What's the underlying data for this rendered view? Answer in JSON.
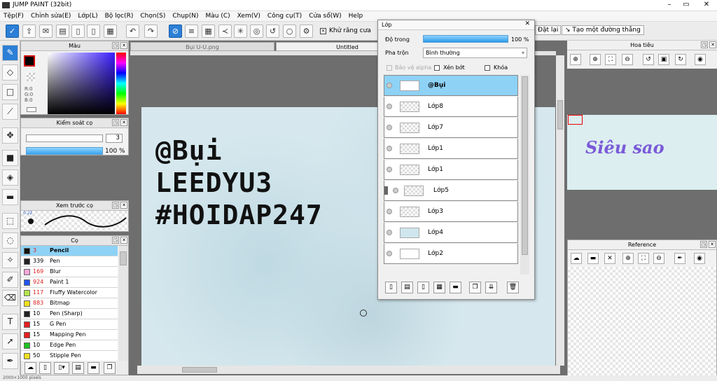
{
  "window": {
    "title": "JUMP PAINT (32bit)"
  },
  "menu": [
    "Tệp(F)",
    "Chỉnh sửa(E)",
    "Lớp(L)",
    "Bộ lọc(R)",
    "Chọn(S)",
    "Chụp(N)",
    "Màu (C)",
    "Xem(V)",
    "Công cụ(T)",
    "Cửa sổ(W)",
    "Help"
  ],
  "toolbar": {
    "antialias_label": "Khử răng cưa",
    "reset_label": "Đặt lại",
    "straight_line_label": "Tạo một đường thẳng"
  },
  "color_panel": {
    "title": "Màu",
    "r": "R:0",
    "g": "G:0",
    "b": "B:0"
  },
  "size_panel": {
    "title": "Kiểm soát cọ",
    "size": "3",
    "opacity": "100 %"
  },
  "preview_panel": {
    "title": "Xem trước cọ",
    "size_hint": "0.22"
  },
  "brush_panel": {
    "title": "Cọ",
    "brushes": [
      {
        "size": "3",
        "name": "Pencil",
        "color": "#111111",
        "red": true
      },
      {
        "size": "339",
        "name": "Pen",
        "color": "#222222",
        "red": false
      },
      {
        "size": "169",
        "name": "Blur",
        "color": "#f4a6d9",
        "red": true
      },
      {
        "size": "924",
        "name": "Paint 1",
        "color": "#2255ee",
        "red": true
      },
      {
        "size": "117",
        "name": "Fluffy Watercolor",
        "color": "#b6e64a",
        "red": true
      },
      {
        "size": "883",
        "name": "Bitmap",
        "color": "#f0e020",
        "red": true
      },
      {
        "size": "10",
        "name": "Pen (Sharp)",
        "color": "#222222",
        "red": false
      },
      {
        "size": "15",
        "name": "G Pen",
        "color": "#e62020",
        "red": false
      },
      {
        "size": "15",
        "name": "Mapping Pen",
        "color": "#e62020",
        "red": false
      },
      {
        "size": "10",
        "name": "Edge Pen",
        "color": "#20c020",
        "red": false
      },
      {
        "size": "50",
        "name": "Stipple Pen",
        "color": "#f0e020",
        "red": false
      }
    ]
  },
  "tabs": [
    "Bụi U-U.png",
    "Untitled"
  ],
  "artwork": {
    "lines": [
      "@Bụi",
      "LEEDYU3",
      "#HOIDAP247"
    ]
  },
  "layer_window": {
    "title": "Lớp",
    "opacity_label": "Độ trong",
    "opacity_value": "100 %",
    "blend_label": "Pha trộn",
    "blend_value": "Bình thường",
    "protect_alpha": "Bảo vệ alpha",
    "clip": "Xén bớt",
    "lock": "Khóa",
    "layers": [
      "@Bụi",
      "Lớp8",
      "Lớp7",
      "Lớp1",
      "Lớp1",
      "Lớp5",
      "Lớp3",
      "Lớp4",
      "Lớp2"
    ]
  },
  "navigator": {
    "title": "Hoa tiêu",
    "preview_text": "Siêu sao"
  },
  "reference": {
    "title": "Reference"
  },
  "status": {
    "text": "2000×1000 pixels"
  }
}
